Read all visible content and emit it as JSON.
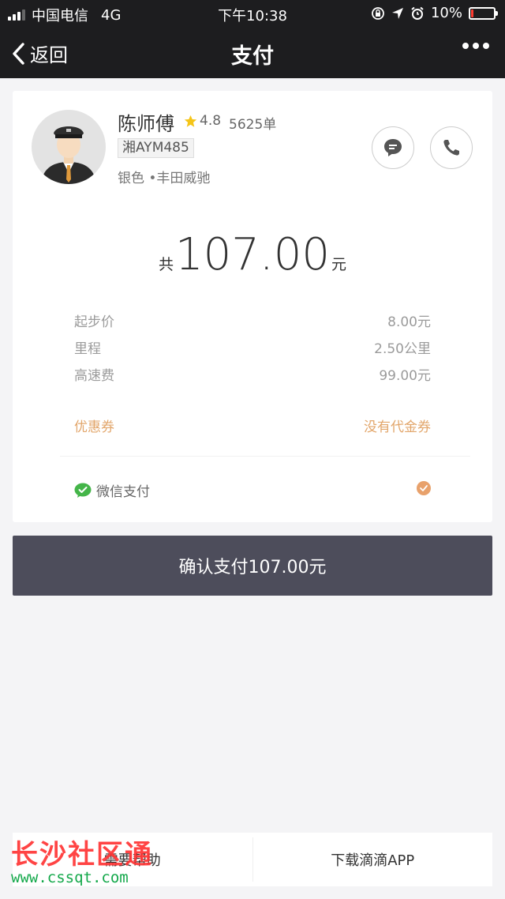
{
  "status_bar": {
    "carrier": "中国电信",
    "network": "4G",
    "time": "下午10:38",
    "battery": "10%",
    "battery_level": 0.1
  },
  "nav": {
    "back_label": "返回",
    "title": "支付"
  },
  "driver": {
    "name": "陈师傅",
    "rating": "4.8",
    "orders": "5625单",
    "plate": "湘AYM485",
    "car": "银色 •丰田威驰"
  },
  "fare": {
    "prefix": "共",
    "amount": "107.00",
    "unit": "元",
    "items": [
      {
        "label": "起步价",
        "value": "8.00元"
      },
      {
        "label": "里程",
        "value": "2.50公里"
      },
      {
        "label": "高速费",
        "value": "99.00元"
      }
    ],
    "coupon_label": "优惠券",
    "coupon_value": "没有代金券"
  },
  "payment": {
    "method": "微信支付"
  },
  "confirm_button": "确认支付107.00元",
  "bottom": {
    "help": "需要帮助",
    "download": "下载滴滴APP"
  },
  "watermark": {
    "title": "长沙社区通",
    "url": "www.cssqt.com"
  },
  "colors": {
    "bar_bg": "#1d1d1f",
    "accent": "#e8a16b",
    "confirm_bg": "#4d4d5b",
    "wechat_green": "#44b549",
    "star": "#f5c518"
  }
}
